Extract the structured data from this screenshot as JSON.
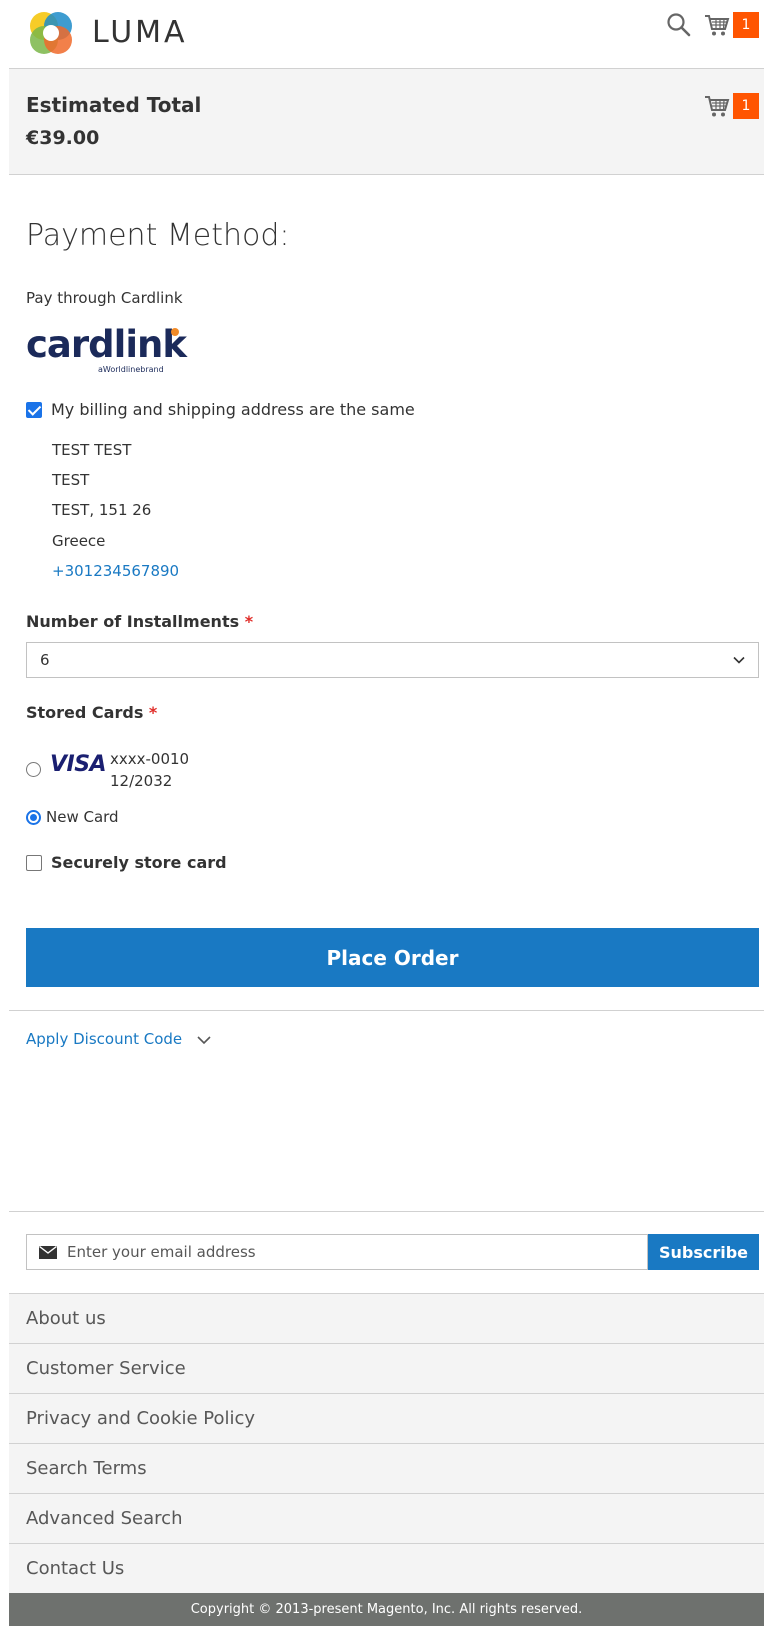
{
  "header": {
    "logo_text": "LUMA",
    "cart_count": "1"
  },
  "summary": {
    "label": "Estimated Total",
    "value": "€39.00",
    "cart_count": "1"
  },
  "payment": {
    "title": "Payment Method:",
    "method_label": "Pay through Cardlink",
    "brand_word": "cardlink",
    "brand_sub": "aWorldlinebrand",
    "billing_same_label": "My billing and shipping address are the same",
    "billing_same_checked": true,
    "address": [
      "TEST TEST",
      "TEST",
      "TEST, 151 26",
      "Greece"
    ],
    "phone": "+301234567890",
    "installments_label": "Number of Installments",
    "installments_value": "6",
    "stored_cards_label": "Stored Cards",
    "required_mark": "*",
    "stored_card": {
      "brand": "VISA",
      "number": "xxxx-0010",
      "expiry": "12/2032"
    },
    "new_card_label": "New Card",
    "store_card_label": "Securely store card",
    "place_order_label": "Place Order"
  },
  "discount": {
    "label": "Apply Discount Code"
  },
  "newsletter": {
    "placeholder": "Enter your email address",
    "subscribe_label": "Subscribe"
  },
  "footer": {
    "links": [
      "About us",
      "Customer Service",
      "Privacy and Cookie Policy",
      "Search Terms",
      "Advanced Search",
      "Contact Us"
    ],
    "copyright": "Copyright © 2013-present Magento, Inc. All rights reserved."
  },
  "colors": {
    "accent": "#1979c3",
    "badge": "#ff5501",
    "required": "#e02b27"
  }
}
